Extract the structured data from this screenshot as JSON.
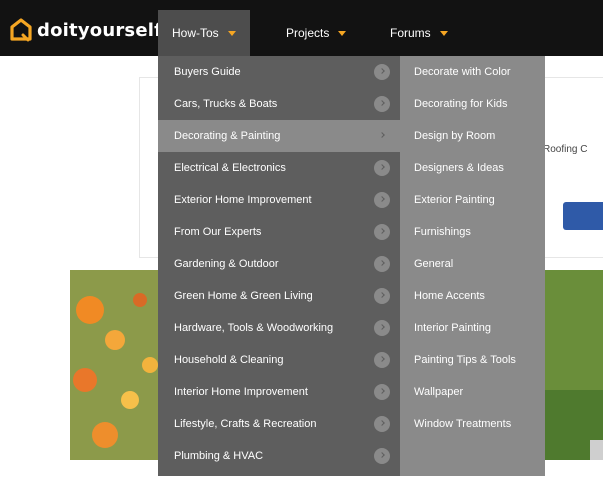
{
  "brand": {
    "name": "doityourself",
    "accent": "#f5a623"
  },
  "nav": [
    {
      "label": "How-Tos",
      "active": true
    },
    {
      "label": "Projects",
      "active": false
    },
    {
      "label": "Forums",
      "active": false
    }
  ],
  "background": {
    "card_text": "Roofing C"
  },
  "menu": {
    "categories": [
      "Buyers Guide",
      "Cars, Trucks & Boats",
      "Decorating & Painting",
      "Electrical & Electronics",
      "Exterior Home Improvement",
      "From Our Experts",
      "Gardening & Outdoor",
      "Green Home & Green Living",
      "Hardware, Tools & Woodworking",
      "Household & Cleaning",
      "Interior Home Improvement",
      "Lifestyle, Crafts & Recreation",
      "Plumbing & HVAC"
    ],
    "active_category": "Decorating & Painting",
    "subcategories": [
      "Decorate with Color",
      "Decorating for Kids",
      "Design by Room",
      "Designers & Ideas",
      "Exterior Painting",
      "Furnishings",
      "General",
      "Home Accents",
      "Interior Painting",
      "Painting Tips & Tools",
      "Wallpaper",
      "Window Treatments"
    ]
  }
}
